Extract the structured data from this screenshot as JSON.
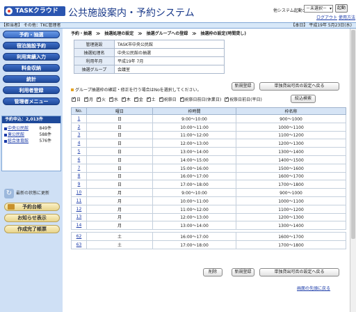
{
  "header": {
    "logo_text": "TASKクラウド",
    "app_title": "公共施設案内・予約システム",
    "other_system_label": "他システム起動：",
    "system_select_value": "－未選択－",
    "launch_label": "起動",
    "logout_label": "ログアウト",
    "help_label": "使用方法"
  },
  "topbar": {
    "user": "【担当者】 その他：TKC管理者",
    "date": "【本日】 平成19年 5月23日(水)"
  },
  "sidebar": {
    "menu": [
      {
        "label": "予約・抽選"
      },
      {
        "label": "宿泊施設予約"
      },
      {
        "label": "利用実績入力"
      },
      {
        "label": "料金収納"
      },
      {
        "label": "統計"
      },
      {
        "label": "利用者登録"
      },
      {
        "label": "管理者メニュー"
      }
    ],
    "count_title": "予約申込：2,013件",
    "counts": [
      {
        "name": "中央公民館",
        "value": "849件"
      },
      {
        "name": "東公民館",
        "value": "588件"
      },
      {
        "name": "総合体育館",
        "value": "576件"
      }
    ],
    "refresh_label": "最新の状態に更新",
    "buttons": [
      {
        "label": "予約台帳"
      },
      {
        "label": "お知らせ表示"
      },
      {
        "label": "作成完了帳票"
      }
    ]
  },
  "main": {
    "breadcrumb": "予約・抽選　≫　抽選処理の設定　≫　抽選グループへの登録　≫　抽選枠の設定(時間貸し)",
    "info": [
      {
        "key": "管理施設",
        "value": "TASK市中央公民館"
      },
      {
        "key": "抽選処理名",
        "value": "中央公民館の抽選"
      },
      {
        "key": "利用年月",
        "value": "平成19年 7月"
      },
      {
        "key": "抽選グループ",
        "value": "会議室"
      }
    ],
    "note": "グループ抽選枠の確認・修正を行う場合はNoを選択してください。",
    "new_register_label": "新規登録",
    "copy_settings_label": "単独貸出可否の設定へ戻る",
    "filter_label": "絞込検索",
    "days": [
      {
        "label": "日"
      },
      {
        "label": "月"
      },
      {
        "label": "火"
      },
      {
        "label": "水"
      },
      {
        "label": "木"
      },
      {
        "label": "金"
      },
      {
        "label": "土"
      },
      {
        "label": "祝祭日"
      },
      {
        "label": "祝祭日前日(休業日)"
      },
      {
        "label": "祝祭日前日(平日)"
      }
    ],
    "columns": [
      "No.",
      "曜日",
      "枠時間",
      "枠名称"
    ],
    "rows": [
      {
        "no": "1",
        "day": "日",
        "time": "9:00〜10:00",
        "name": "900〜1000"
      },
      {
        "no": "2",
        "day": "日",
        "time": "10:00〜11:00",
        "name": "1000〜1100"
      },
      {
        "no": "3",
        "day": "日",
        "time": "11:00〜12:00",
        "name": "1100〜1200"
      },
      {
        "no": "4",
        "day": "日",
        "time": "12:00〜13:00",
        "name": "1200〜1300"
      },
      {
        "no": "5",
        "day": "日",
        "time": "13:00〜14:00",
        "name": "1300〜1400"
      },
      {
        "no": "6",
        "day": "日",
        "time": "14:00〜15:00",
        "name": "1400〜1500"
      },
      {
        "no": "7",
        "day": "日",
        "time": "15:00〜16:00",
        "name": "1500〜1600"
      },
      {
        "no": "8",
        "day": "日",
        "time": "16:00〜17:00",
        "name": "1600〜1700"
      },
      {
        "no": "9",
        "day": "日",
        "time": "17:00〜18:00",
        "name": "1700〜1800"
      },
      {
        "no": "10",
        "day": "月",
        "time": "9:00〜10:00",
        "name": "900〜1000"
      },
      {
        "no": "11",
        "day": "月",
        "time": "10:00〜11:00",
        "name": "1000〜1100"
      },
      {
        "no": "12",
        "day": "月",
        "time": "11:00〜12:00",
        "name": "1100〜1200"
      },
      {
        "no": "13",
        "day": "月",
        "time": "12:00〜13:00",
        "name": "1200〜1300"
      },
      {
        "no": "14",
        "day": "月",
        "time": "13:00〜14:00",
        "name": "1300〜1400"
      },
      {
        "no": "62",
        "day": "土",
        "time": "16:00〜17:00",
        "name": "1600〜1700"
      },
      {
        "no": "63",
        "day": "土",
        "time": "17:00〜18:00",
        "name": "1700〜1800"
      }
    ],
    "delete_label": "削除",
    "back_link": "画面の先頭に戻る"
  }
}
